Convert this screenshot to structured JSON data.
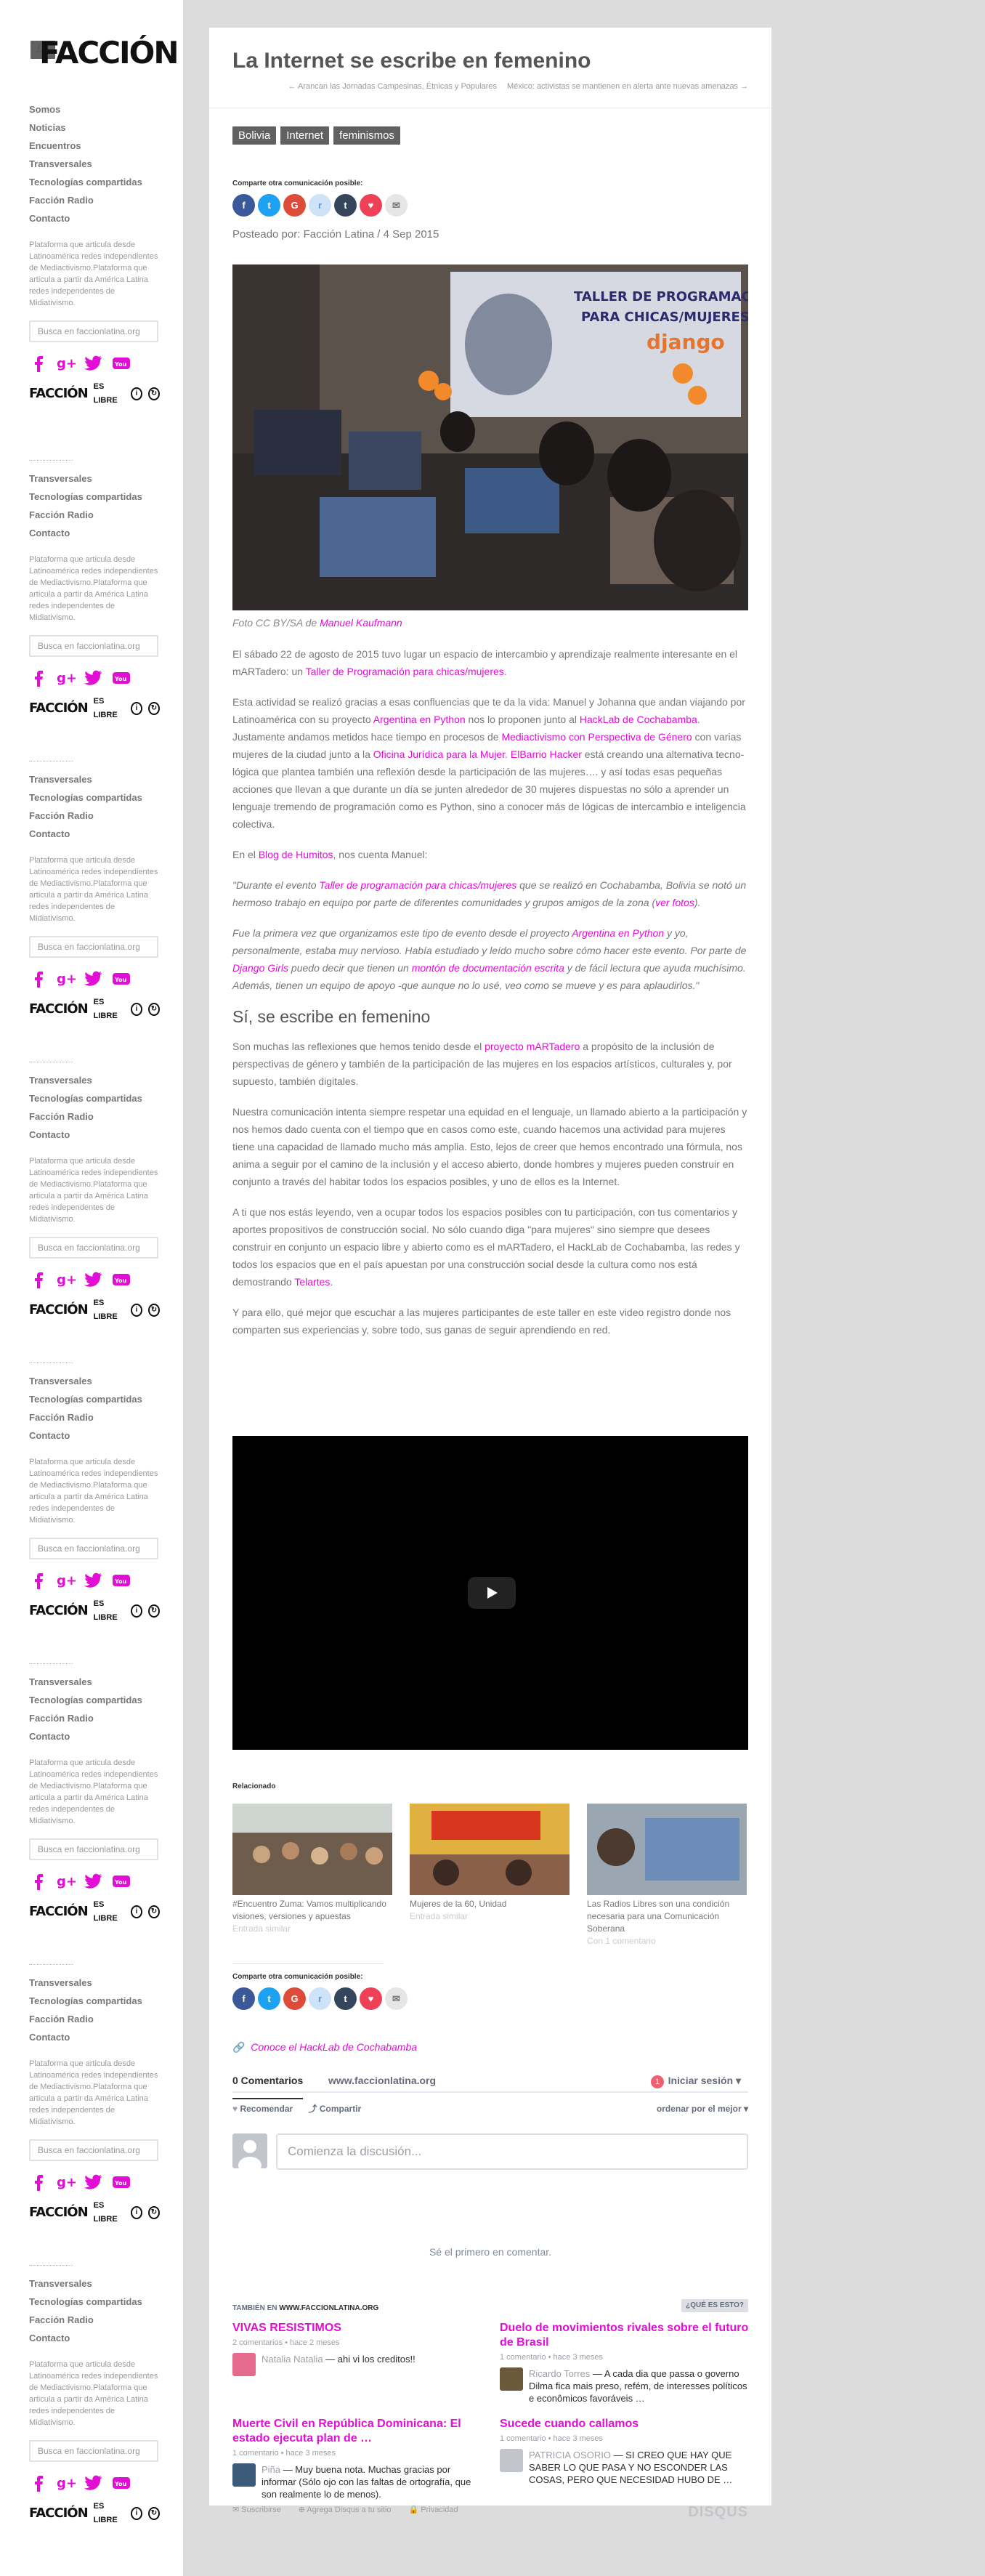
{
  "site": {
    "logo_tag": "La",
    "logo_word": "FACCIÓN"
  },
  "sidebar": {
    "first_menu": [
      "Somos",
      "Noticias",
      "Encuentros",
      "Transversales",
      "Tecnologías compartidas",
      "Facción Radio",
      "Contacto"
    ],
    "repeat_menu": [
      "Transversales",
      "Tecnologías compartidas",
      "Facción Radio",
      "Contacto"
    ],
    "description": "Plataforma que articula desde Latinoamérica redes independientes de Mediactivismo.Plataforma que articula a partir da América Latina redes independentes de Midiativismo.",
    "search_placeholder": "Busca en faccionlatina.org",
    "libre_word": "FACCIÓN",
    "libre_tag": "ES LIBRE",
    "icons": [
      "facebook-icon",
      "google-plus-icon",
      "twitter-icon",
      "youtube-icon"
    ],
    "icon_color": "#e20ed6"
  },
  "post": {
    "title": "La Internet se escribe en femenino",
    "prev": "← Arancan las Jornadas Campesinas, Étnicas y Populares",
    "next": "México: activistas se mantienen en alerta ante nuevas amenazas →",
    "tags": [
      "Bolivia",
      "Internet",
      "feminismos"
    ],
    "share_label": "Comparte otra comunicación posible:",
    "byline": "Posteado por: Facción Latina / 4 Sep 2015",
    "caption_pre": "Foto CC BY/SA de ",
    "caption_link": "Manuel Kaufmann",
    "hero_screen_lines": [
      "TALLER DE PROGRAMACIÓN",
      "PARA CHICAS/MUJERES",
      "django"
    ],
    "p1_a": "El sábado 22 de agosto de 2015 tuvo lugar un espacio de intercambio y aprendizaje realmente interesante en el mARTadero: un ",
    "p1_link": "Taller de Programación para chicas/mujeres",
    "p1_b": ".",
    "p2_a": "Esta actividad se realizó gracias a esas confluencias que te da la vida: Manuel y Johanna que andan viajando por Latinoamérica con su proyecto ",
    "p2_l1": "Argentina en Python",
    "p2_b": " nos lo proponen junto al ",
    "p2_l2": "HackLab de Cochabamba",
    "p2_c": ". Justamente andamos metidos hace tiempo en procesos de ",
    "p2_l3": "Mediactivismo con Perspectiva de Género",
    "p2_d": " con varias mujeres de la ciudad junto a la ",
    "p2_l4": "Oficina Jurídica para la Mujer",
    "p2_e": ". ",
    "p2_l5": "ElBarrio Hacker",
    "p2_f": " está creando una alternativa tecno-lógica que plantea también una reflexión desde la participación de las mujeres…. y así todas esas pequeñas acciones que llevan a que durante un día se junten alrededor de 30 mujeres dispuestas no sólo a aprender un lenguaje tremendo de programación como es Python, sino a conocer más de lógicas de intercambio e inteligencia colectiva.",
    "p3_a": "En el ",
    "p3_link": "Blog de Humitos",
    "p3_b": ", nos cuenta Manuel:",
    "q1_a": "\"Durante el evento ",
    "q1_link": "Taller de programación para chicas/mujeres",
    "q1_b": " que se realizó en Cochabamba, Bolivia se notó un hermoso trabajo en equipo por parte de diferentes comunidades y grupos amigos de la zona (",
    "q1_link2": "ver fotos",
    "q1_c": ").",
    "q2_a": "Fue la primera vez que organizamos este tipo de evento desde el proyecto ",
    "q2_l1": "Argentina en Python",
    "q2_b": " y yo, personalmente, estaba muy nervioso. Había estudiado y leído mucho sobre cómo hacer este evento. Por parte de ",
    "q2_l2": "Django Girls",
    "q2_c": " puedo decir que tienen un ",
    "q2_l3": "montón de documentación escrita",
    "q2_d": " y de fácil lectura que ayuda muchísimo. Además, tienen un equipo de apoyo -que aunque no lo usé, veo como se mueve y es para aplaudirlos.\"",
    "h2": "Sí, se escribe en femenino",
    "p4_a": "Son muchas las reflexiones que hemos tenido desde el ",
    "p4_link": "proyecto mARTadero",
    "p4_b": " a propósito de la inclusión de perspectivas de género y también de la participación de las mujeres en los espacios artísticos, culturales y, por supuesto, también digitales.",
    "p5": "Nuestra comunicación intenta siempre respetar una equidad en el lenguaje, un llamado abierto a la participación y nos hemos dado cuenta con el tiempo que en casos como este, cuando hacemos una actividad para mujeres tiene una capacidad de llamado mucho más amplia. Esto, lejos de creer que hemos encontrado una fórmula, nos anima a seguir por el camino de la inclusión y el acceso abierto, donde hombres y mujeres pueden construir en conjunto a través del habitar todos los espacios posibles, y uno de ellos es la Internet.",
    "p6_a": "A ti que nos estás leyendo, ven a ocupar todos los espacios posibles con tu participación, con tus comentarios y aportes propositivos de construcción social. No sólo cuando diga \"para mujeres\" sino siempre que desees construir en conjunto un espacio libre y abierto como es el mARTadero, el HackLab de Cochabamba, las redes y todos los espacios que en el país apuestan por una construcción social desde la cultura como nos está demostrando ",
    "p6_link": "Telartes",
    "p6_b": ".",
    "p7": "Y para ello, qué mejor que escuchar a las mujeres participantes de este taller en este video registro donde nos comparten sus experiencias y, sobre todo, sus ganas de seguir aprendiendo en red.",
    "related_label": "Relacionado",
    "related": [
      {
        "title": "#Encuentro Zuma: Vamos multiplicando visiones, versiones y apuestas",
        "sub": "Entrada similar"
      },
      {
        "title": "Mujeres de la 60, Unidad",
        "sub": "Entrada similar"
      },
      {
        "title": "Las Radios Libres son una condición necesaria para una Comunicación Soberana",
        "sub": "Con 1 comentario"
      }
    ],
    "conoce": "Conoce el HackLab de Cochabamba"
  },
  "disqus": {
    "count": "0 Comentarios",
    "site": "www.faccionlatina.org",
    "badge": "1",
    "login": "Iniciar sesión",
    "recommend": "Recomendar",
    "share": "Compartir",
    "sort": "ordenar por el mejor",
    "placeholder": "Comienza la discusión...",
    "first": "Sé el primero en comentar.",
    "also_pre": "TAMBIÉN EN ",
    "also_site": "WWW.FACCIONLATINA.ORG",
    "what": "¿QUÉ ES ESTO?",
    "recs": [
      {
        "title": "VIVAS RESISTIMOS",
        "meta": "2 comentarios • hace 2 meses",
        "author": "Natalia Natalia",
        "text": "— ahi vi los creditos!!"
      },
      {
        "title": "Duelo de movimientos rivales sobre el futuro de Brasil",
        "meta": "1 comentario • hace 3 meses",
        "author": "Ricardo Torres",
        "text": "— A cada dia que passa o governo Dilma fica mais preso, refém, de interesses políticos e econômicos favoráveis …"
      },
      {
        "title": "Muerte Civil en República Dominicana: El estado ejecuta plan de …",
        "meta": "1 comentario • hace 3 meses",
        "author": "Piña",
        "text": "— Muy buena nota. Muchas gracias por informar (Sólo ojo con las faltas de ortografía, que son realmente lo de menos)."
      },
      {
        "title": "Sucede cuando callamos",
        "meta": "1 comentario • hace 3 meses",
        "author": "PATRICIA OSORIO",
        "text": "— SI CREO QUE HAY QUE SABER LO QUE PASA Y NO ESCONDER LAS COSAS, PERO QUE NECESIDAD HUBO DE …"
      }
    ],
    "footer": [
      "Suscribirse",
      "Agrega Disqus a tu sitio",
      "Privacidad"
    ],
    "logo": "DISQUS"
  },
  "colors": {
    "accent": "#e20ed6",
    "tag_bg": "#616161",
    "background": "#dcdcdc"
  }
}
